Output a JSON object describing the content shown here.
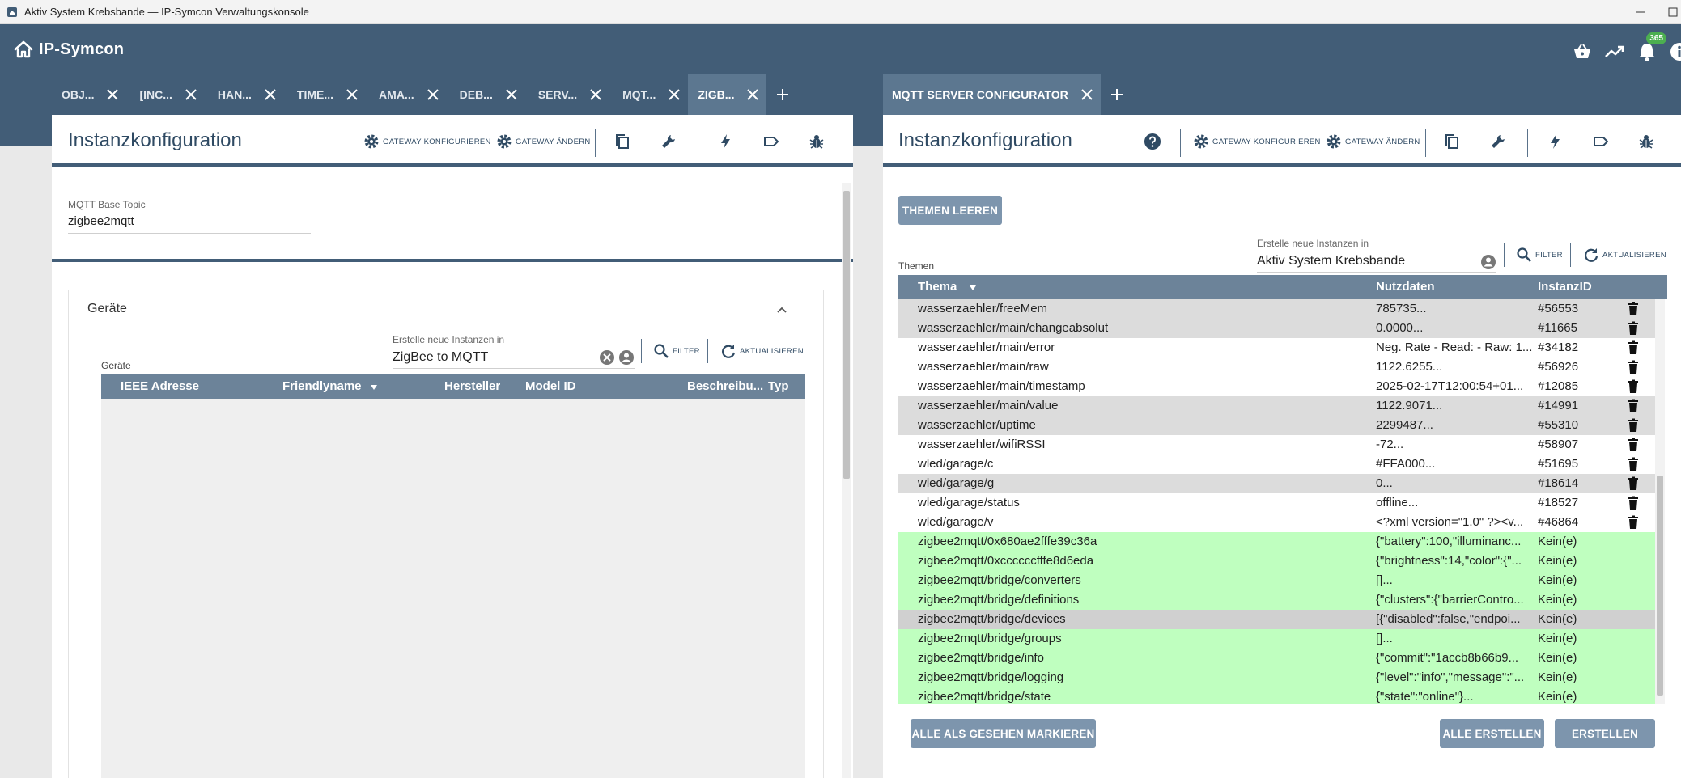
{
  "window": {
    "title": "Aktiv System Krebsbande — IP-Symcon Verwaltungskonsole"
  },
  "app": {
    "brand": "IP-Symcon",
    "notification_count": "365"
  },
  "tabs_left": [
    {
      "label": "OBJ..."
    },
    {
      "label": "[INC..."
    },
    {
      "label": "HAN..."
    },
    {
      "label": "TIME..."
    },
    {
      "label": "AMA..."
    },
    {
      "label": "DEB..."
    },
    {
      "label": "SERV..."
    },
    {
      "label": "MQT..."
    },
    {
      "label": "ZIGB...",
      "active": true
    }
  ],
  "tabs_right": [
    {
      "label": "MQTT SERVER CONFIGURATOR",
      "active": true
    }
  ],
  "left_panel": {
    "title": "Instanzkonfiguration",
    "toolbar": {
      "gateway_configure": "GATEWAY KONFIGURIEREN",
      "gateway_change": "GATEWAY ÄNDERN"
    },
    "base_topic": {
      "label": "MQTT Base Topic",
      "value": "zigbee2mqtt"
    },
    "devices": {
      "section_title": "Geräte",
      "list_label": "Geräte",
      "create_in": {
        "label": "Erstelle neue Instanzen in",
        "value": "ZigBee to MQTT"
      },
      "filter": "FILTER",
      "refresh": "AKTUALISIEREN",
      "columns": [
        "IEEE Adresse",
        "Friendlyname",
        "Hersteller",
        "Model ID",
        "Beschreibu...",
        "Typ"
      ]
    }
  },
  "right_panel": {
    "title": "Instanzkonfiguration",
    "toolbar": {
      "gateway_configure": "GATEWAY KONFIGURIEREN",
      "gateway_change": "GATEWAY ÄNDERN"
    },
    "clear_topics_button": "THEMEN LEEREN",
    "create_in": {
      "label": "Erstelle neue Instanzen in",
      "value": "Aktiv System Krebsbande"
    },
    "filter": "FILTER",
    "refresh": "AKTUALISIEREN",
    "topics_label": "Themen",
    "columns": {
      "topic": "Thema",
      "payload": "Nutzdaten",
      "instance": "InstanzID"
    },
    "rows": [
      {
        "topic": "wasserzaehler/freeMem",
        "payload": "785735...",
        "instance": "#56553",
        "state": "grey"
      },
      {
        "topic": "wasserzaehler/main/changeabsolut",
        "payload": "0.0000...",
        "instance": "#11665",
        "state": "grey"
      },
      {
        "topic": "wasserzaehler/main/error",
        "payload": "Neg. Rate - Read: - Raw: 1...",
        "instance": "#34182",
        "state": "white"
      },
      {
        "topic": "wasserzaehler/main/raw",
        "payload": "1122.6255...",
        "instance": "#56926",
        "state": "white"
      },
      {
        "topic": "wasserzaehler/main/timestamp",
        "payload": "2025-02-17T12:00:54+01...",
        "instance": "#12085",
        "state": "white"
      },
      {
        "topic": "wasserzaehler/main/value",
        "payload": "1122.9071...",
        "instance": "#14991",
        "state": "grey"
      },
      {
        "topic": "wasserzaehler/uptime",
        "payload": "2299487...",
        "instance": "#55310",
        "state": "grey"
      },
      {
        "topic": "wasserzaehler/wifiRSSI",
        "payload": "-72...",
        "instance": "#58907",
        "state": "white"
      },
      {
        "topic": "wled/garage/c",
        "payload": "#FFA000...",
        "instance": "#51695",
        "state": "white"
      },
      {
        "topic": "wled/garage/g",
        "payload": "0...",
        "instance": "#18614",
        "state": "grey"
      },
      {
        "topic": "wled/garage/status",
        "payload": "offline...",
        "instance": "#18527",
        "state": "white"
      },
      {
        "topic": "wled/garage/v",
        "payload": "<?xml version=\"1.0\" ?><v...",
        "instance": "#46864",
        "state": "white"
      },
      {
        "topic": "zigbee2mqtt/0x680ae2fffe39c36a",
        "payload": "{\"battery\":100,\"illuminanc...",
        "instance": "Kein(e)",
        "state": "green"
      },
      {
        "topic": "zigbee2mqtt/0xccccccfffe8d6eda",
        "payload": "{\"brightness\":14,\"color\":{\"...",
        "instance": "Kein(e)",
        "state": "green"
      },
      {
        "topic": "zigbee2mqtt/bridge/converters",
        "payload": "[]...",
        "instance": "Kein(e)",
        "state": "green"
      },
      {
        "topic": "zigbee2mqtt/bridge/definitions",
        "payload": "{\"clusters\":{\"barrierContro...",
        "instance": "Kein(e)",
        "state": "green"
      },
      {
        "topic": "zigbee2mqtt/bridge/devices",
        "payload": "[{\"disabled\":false,\"endpoi...",
        "instance": "Kein(e)",
        "state": "selected"
      },
      {
        "topic": "zigbee2mqtt/bridge/groups",
        "payload": "[]...",
        "instance": "Kein(e)",
        "state": "green"
      },
      {
        "topic": "zigbee2mqtt/bridge/info",
        "payload": "{\"commit\":\"1accb8b66b9...",
        "instance": "Kein(e)",
        "state": "green"
      },
      {
        "topic": "zigbee2mqtt/bridge/logging",
        "payload": "{\"level\":\"info\",\"message\":\"...",
        "instance": "Kein(e)",
        "state": "green"
      },
      {
        "topic": "zigbee2mqtt/bridge/state",
        "payload": "{\"state\":\"online\"}...",
        "instance": "Kein(e)",
        "state": "green"
      }
    ],
    "mark_seen_button": "ALLE ALS GESEHEN MARKIEREN",
    "create_all_button": "ALLE ERSTELLEN",
    "create_button": "ERSTELLEN"
  },
  "colors": {
    "header": "#425d77",
    "row_grey": "#dcdcdc",
    "row_green": "#bfffbf",
    "row_selected": "#d0d0d0",
    "button": "#7d95ad"
  }
}
